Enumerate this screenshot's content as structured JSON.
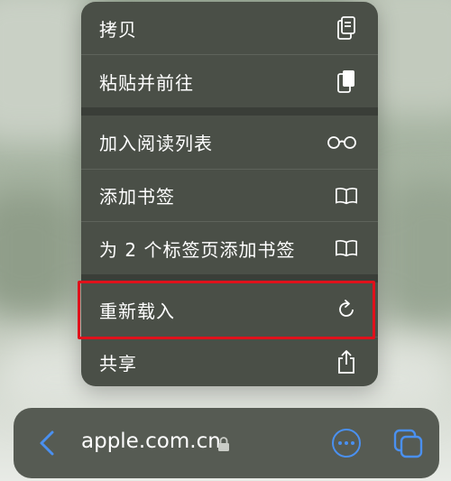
{
  "menu": {
    "items": [
      {
        "label": "拷贝",
        "icon": "copy-icon"
      },
      {
        "label": "粘贴并前往",
        "icon": "paste-icon"
      },
      {
        "label": "加入阅读列表",
        "icon": "reading-list-glasses-icon"
      },
      {
        "label": "添加书签",
        "icon": "book-icon"
      },
      {
        "label": "为 2 个标签页添加书签",
        "icon": "book-icon"
      },
      {
        "label": "重新载入",
        "icon": "reload-icon"
      },
      {
        "label": "共享",
        "icon": "share-icon"
      }
    ],
    "highlighted_item": "重新载入",
    "highlight_color": "#e0111b"
  },
  "address_bar": {
    "url": "apple.com.cn",
    "secure": true,
    "accent_color": "#4a90f0"
  }
}
